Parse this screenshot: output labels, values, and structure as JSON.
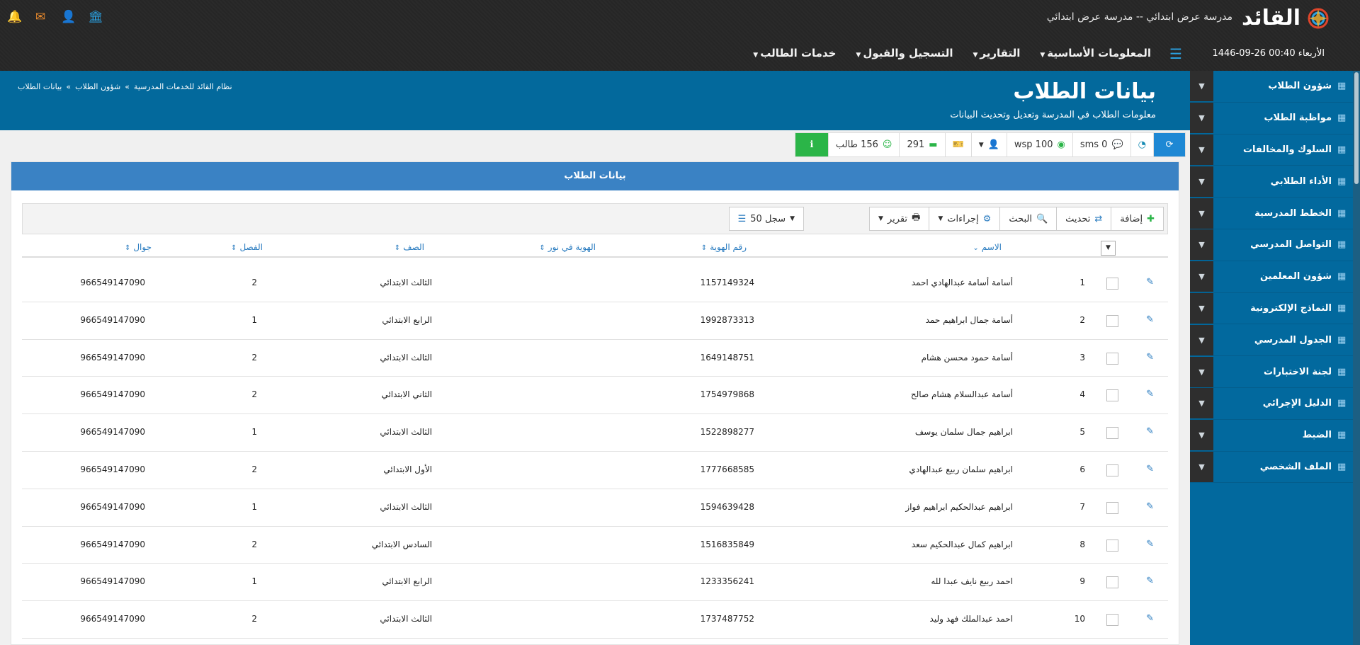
{
  "header": {
    "logo_text": "القائد",
    "school_name": "مدرسة عرض ابتدائي -- مدرسة عرض ابتدائي",
    "datetime": "1446-09-26 00:40 الأربعاء",
    "menu": [
      {
        "label": "خدمات الطالب"
      },
      {
        "label": "التسجيل والقبول"
      },
      {
        "label": "التقارير"
      },
      {
        "label": "المعلومات الأساسية"
      }
    ]
  },
  "sidebar": {
    "items": [
      {
        "label": "شؤون الطلاب"
      },
      {
        "label": "مواظبة الطلاب"
      },
      {
        "label": "السلوك والمخالفات"
      },
      {
        "label": "الأداء الطلابي"
      },
      {
        "label": "الخطط المدرسية"
      },
      {
        "label": "التواصل المدرسي"
      },
      {
        "label": "شؤون المعلمين"
      },
      {
        "label": "النماذج الإلكترونية"
      },
      {
        "label": "الجدول المدرسي"
      },
      {
        "label": "لجنة الاختبارات"
      },
      {
        "label": "الدليل الإجرائي"
      },
      {
        "label": "الضبط"
      },
      {
        "label": "الملف الشخصي"
      }
    ]
  },
  "page": {
    "title": "بيانات الطلاب",
    "subtitle": "معلومات الطلاب في المدرسة وتعديل وتحديث البيانات",
    "breadcrumb": [
      "نظام القائد للخدمات المدرسية",
      "»",
      "شؤون الطلاب",
      "»",
      "بيانات الطلاب"
    ]
  },
  "stats": {
    "sms": "sms 0",
    "wsp": "wsp 100",
    "battery": "291",
    "students": "156 طالب"
  },
  "panel": {
    "title": "بيانات الطلاب",
    "buttons": {
      "add": "إضافة",
      "refresh": "تحديث",
      "search": "البحث",
      "actions": "إجراءات",
      "report": "تقرير",
      "records": "50 سجل"
    }
  },
  "table": {
    "columns": {
      "name": "الاسم",
      "id_number": "رقم الهوية",
      "noor_id": "الهوية في نور",
      "grade": "الصف",
      "class": "الفصل",
      "phone": "جوال"
    },
    "rows": [
      {
        "num": "1",
        "name": "أسامة أسامة عبدالهادي احمد",
        "id": "1157149324",
        "grade": "الثالث الابتدائي",
        "class": "2",
        "phone": "966549147090"
      },
      {
        "num": "2",
        "name": "أسامة جمال ابراهيم حمد",
        "id": "1992873313",
        "grade": "الرابع الابتدائي",
        "class": "1",
        "phone": "966549147090"
      },
      {
        "num": "3",
        "name": "أسامة حمود محسن هشام",
        "id": "1649148751",
        "grade": "الثالث الابتدائي",
        "class": "2",
        "phone": "966549147090"
      },
      {
        "num": "4",
        "name": "أسامة عبدالسلام هشام صالح",
        "id": "1754979868",
        "grade": "الثاني الابتدائي",
        "class": "2",
        "phone": "966549147090"
      },
      {
        "num": "5",
        "name": "ابراهيم جمال سلمان يوسف",
        "id": "1522898277",
        "grade": "الثالث الابتدائي",
        "class": "1",
        "phone": "966549147090"
      },
      {
        "num": "6",
        "name": "ابراهيم سلمان ربيع عبدالهادي",
        "id": "1777668585",
        "grade": "الأول الابتدائي",
        "class": "2",
        "phone": "966549147090"
      },
      {
        "num": "7",
        "name": "ابراهيم عبدالحكيم ابراهيم فواز",
        "id": "1594639428",
        "grade": "الثالث الابتدائي",
        "class": "1",
        "phone": "966549147090"
      },
      {
        "num": "8",
        "name": "ابراهيم كمال عبدالحكيم سعد",
        "id": "1516835849",
        "grade": "السادس الابتدائي",
        "class": "2",
        "phone": "966549147090"
      },
      {
        "num": "9",
        "name": "احمد ربيع نايف عبدا لله",
        "id": "1233356241",
        "grade": "الرابع الابتدائي",
        "class": "1",
        "phone": "966549147090"
      },
      {
        "num": "10",
        "name": "احمد عبدالملك فهد وليد",
        "id": "1737487752",
        "grade": "الثالث الابتدائي",
        "class": "2",
        "phone": "966549147090"
      }
    ]
  }
}
